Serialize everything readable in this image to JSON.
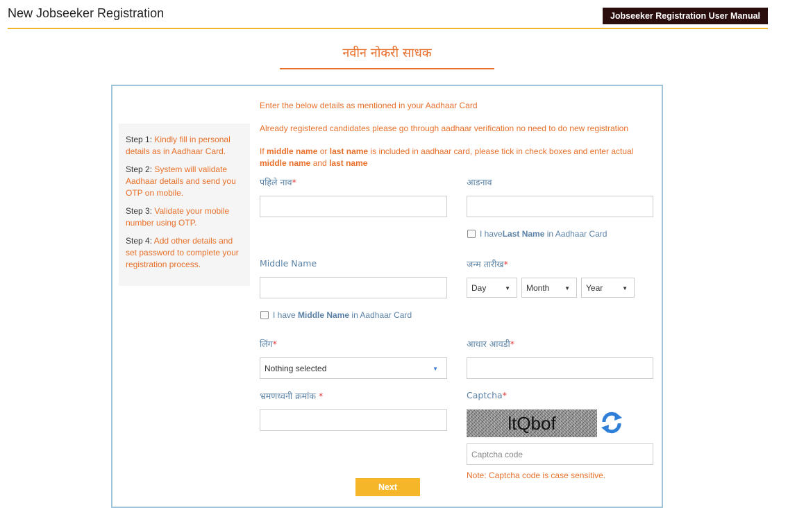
{
  "header": {
    "title": "New Jobseeker Registration",
    "manual_button": "Jobseeker Registration User Manual"
  },
  "form_heading": "नवीन नोकरी साधक",
  "steps": [
    {
      "num": "Step 1:",
      "text": "Kindly fill in personal details as in Aadhaar Card."
    },
    {
      "num": "Step 2:",
      "text": "System will validate Aadhaar details and send you OTP on mobile."
    },
    {
      "num": "Step 3:",
      "text": "Validate your mobile number using OTP."
    },
    {
      "num": "Step 4:",
      "text": "Add other details and set password to complete your registration process."
    }
  ],
  "notes": {
    "line1": "Enter the below details as mentioned in your Aadhaar Card",
    "line2": "Already registered candidates please go through aadhaar verification no need to do new registration",
    "line3_prefix": "If",
    "line3_middle": "middle name",
    "line3_or": "or",
    "line3_last": "last name",
    "line3_rest": "is included in aadhaar card, please tick in check boxes and enter actual",
    "line3_middle2": "middle name",
    "line3_and": "and",
    "line3_last2": "last name"
  },
  "fields": {
    "first_name_label": "पहिले नाव",
    "surname_label": "आडनाव",
    "last_name_check_prefix": "I have",
    "last_name_check_bold": "Last Name",
    "last_name_check_suffix": "in Aadhaar Card",
    "middle_name_label": "Middle Name",
    "middle_name_check_prefix": "I have",
    "middle_name_check_bold": "Middle Name",
    "middle_name_check_suffix": "in Aadhaar Card",
    "dob_label": "जन्म तारीख",
    "dob_day": "Day",
    "dob_month": "Month",
    "dob_year": "Year",
    "gender_label": "लिंग",
    "gender_value": "Nothing selected",
    "aadhaar_label": "आधार आयडी",
    "mobile_label": "भ्रमणध्वनी क्रमांक",
    "captcha_label": "Captcha",
    "captcha_text": "ltQbof",
    "captcha_placeholder": "Captcha code",
    "captcha_note": "Note: Captcha code is case sensitive.",
    "required_mark": "*"
  },
  "next_button": "Next",
  "colors": {
    "accent_orange": "#e8702a",
    "label_blue": "#5a82a6",
    "next_yellow": "#f5b729",
    "header_rule": "#f0b429"
  }
}
